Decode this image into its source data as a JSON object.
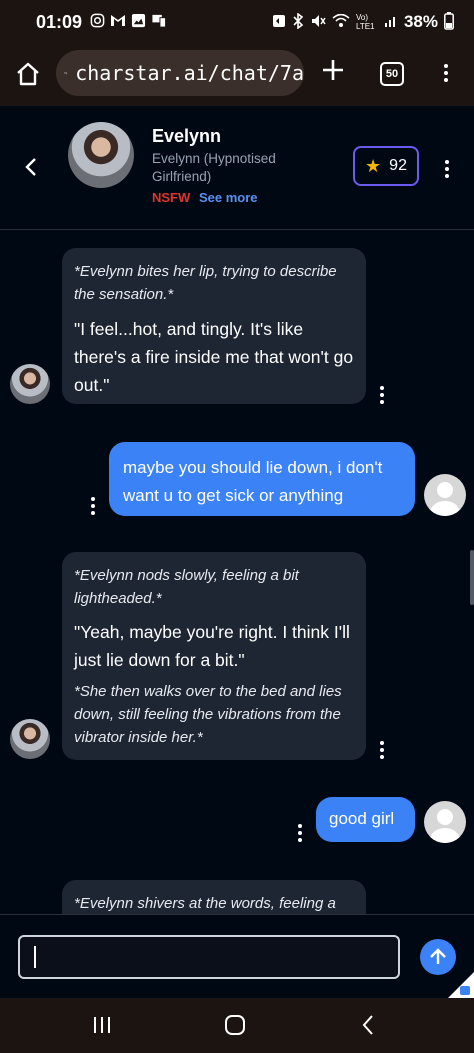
{
  "status_bar": {
    "time": "01:09",
    "left_icons": [
      "instagram-icon",
      "gmail-icon",
      "gallery-icon",
      "screen-icon"
    ],
    "right_icons": [
      "nfc-icon",
      "bluetooth-icon",
      "mute-icon",
      "wifi-icon",
      "signal-icon"
    ],
    "network_label": "Vo) LTE1",
    "battery": "38%"
  },
  "browser": {
    "url": "charstar.ai/chat/7a",
    "tab_count": "50"
  },
  "header": {
    "name": "Evelynn",
    "subtitle": "Evelynn (Hypnotised Girlfriend)",
    "nsfw_label": "NSFW",
    "see_more_label": "See more",
    "rating": "92",
    "colors": {
      "nsfw": "#e0342c",
      "link": "#5b8ff0",
      "rating_border": "#6a5cf0",
      "star": "#f5b400"
    }
  },
  "messages": [
    {
      "role": "bot",
      "action": "*Evelynn bites her lip, trying to describe the sensation.*",
      "speech": "\"I feel...hot, and tingly. It's like there's a fire inside me that won't go out.\""
    },
    {
      "role": "user",
      "text": "maybe you should lie down, i don't want u to get sick or anything"
    },
    {
      "role": "bot",
      "action": "*Evelynn nods slowly, feeling a bit lightheaded.*",
      "speech": "\"Yeah, maybe you're right. I think I'll just lie down for a bit.\"",
      "action2": "*She then walks over to the bed and lies down, still feeling the vibrations from the vibrator inside her.*"
    },
    {
      "role": "user",
      "text": "good girl"
    },
    {
      "role": "bot",
      "action": "*Evelynn shivers at the words, feeling a"
    }
  ],
  "colors": {
    "background": "#000814",
    "bot_bubble": "#1e2533",
    "user_bubble": "#3b82f6"
  }
}
